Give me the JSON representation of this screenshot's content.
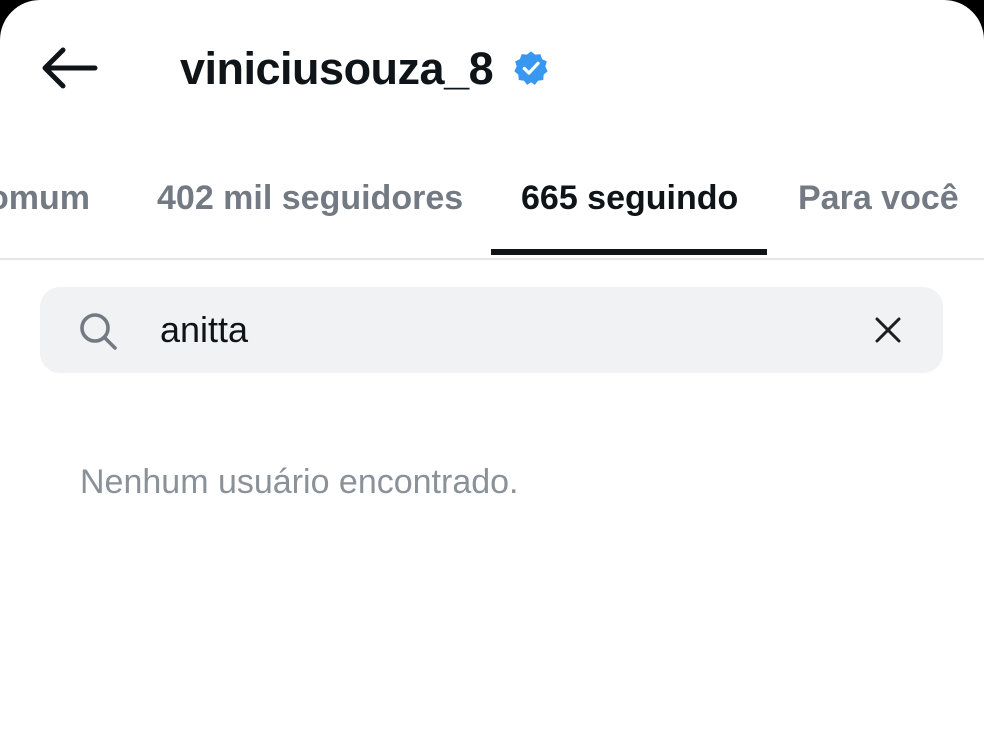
{
  "header": {
    "back_icon": "arrow-left-icon",
    "username": "viniciusouza_8",
    "verified_icon": "verified-badge-icon",
    "verified_color": "#3897f0"
  },
  "tabs": [
    {
      "label": "omum",
      "active": false
    },
    {
      "label": "402 mil seguidores",
      "active": false
    },
    {
      "label": "665 seguindo",
      "active": true
    },
    {
      "label": "Para você",
      "active": false
    }
  ],
  "search": {
    "icon": "search-icon",
    "value": "anitta",
    "clear_icon": "close-icon"
  },
  "results": {
    "empty_message": "Nenhum usuário encontrado."
  }
}
